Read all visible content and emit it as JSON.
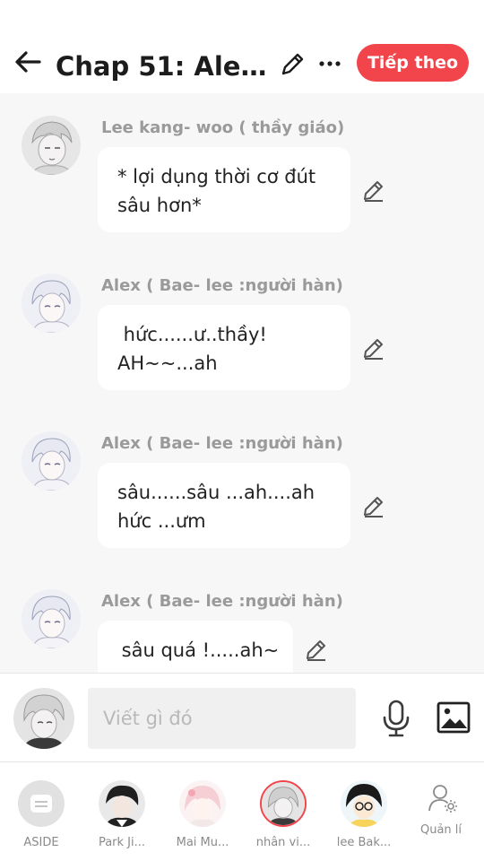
{
  "header": {
    "title": "Chap 51: Alex v...",
    "next_label": "Tiếp theo",
    "icons": [
      "back-arrow-icon",
      "pencil-icon",
      "more-icon"
    ]
  },
  "messages": [
    {
      "sender": "Lee kang- woo ( thầy giáo)",
      "lines": [
        "* lợi dụng thời cơ đút",
        "sâu hơn*"
      ]
    },
    {
      "sender": "Alex (  Bae- lee :người hàn)",
      "lines": [
        " hức......ư..thầy!",
        "AH~~...ah"
      ]
    },
    {
      "sender": "Alex (  Bae- lee :người hàn)",
      "lines": [
        "sâu......sâu ...ah....ah",
        "hức ...ưm"
      ]
    },
    {
      "sender": "Alex (  Bae- lee :người hàn)",
      "lines": [
        " sâu quá !.....ah~"
      ]
    }
  ],
  "composer": {
    "placeholder": "Viết gì đó",
    "icons": [
      "microphone-icon",
      "image-icon"
    ]
  },
  "tabbar": {
    "items": [
      {
        "label": "ASIDE"
      },
      {
        "label": "Park Ji..."
      },
      {
        "label": "Mai Mu..."
      },
      {
        "label": "nhân vi..."
      },
      {
        "label": "lee Bak..."
      }
    ],
    "manage_label": "Quản lí"
  },
  "colors": {
    "accent": "#f2444b",
    "background": "#f7f7f7",
    "bubble": "#ffffff",
    "sender_text": "#9a9a9a"
  }
}
